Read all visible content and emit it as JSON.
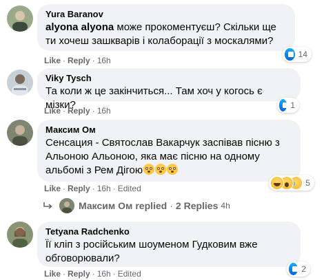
{
  "comments": [
    {
      "author": "Yura Baranov",
      "mention": "alyona alyona",
      "text": " може прокоментуєш? Скільки ще ти хочеш зашкварів і колаборації з москалями?",
      "actions": {
        "like": "Like",
        "reply": "Reply",
        "time": "16h"
      },
      "reaction_count": "14",
      "reaction_types": [
        "like"
      ]
    },
    {
      "author": "Viky Tysch",
      "text": "Та коли ж це закінчиться... Там хоч у когось є мізки?",
      "actions": {
        "like": "Like",
        "reply": "Reply",
        "time": "16h"
      },
      "reaction_count": "1",
      "reaction_types": [
        "like"
      ]
    },
    {
      "author": "Максим Ом",
      "text": "Сенсация - Святослав Вакарчук заспівав пісню з Альоною Альоною, яка має пісню на одному альбомі з Рем Дігою",
      "emoji_count": 3,
      "actions": {
        "like": "Like",
        "reply": "Reply",
        "time": "16h",
        "edited": "Edited"
      },
      "reaction_count": "5",
      "reaction_types": [
        "haha",
        "wow",
        "sad"
      ],
      "replies": {
        "name": "Максим Ом",
        "label": "replied",
        "count_label": "2 Replies",
        "time": "4h"
      }
    },
    {
      "author": "Tetyana Radchenko",
      "text": "Її кліп з російським шоуменом Гудковим вже обговорювали?",
      "actions": {
        "like": "Like",
        "reply": "Reply",
        "time": "16h",
        "edited": "Edited"
      },
      "reaction_count": "2",
      "reaction_types": [
        "like"
      ]
    }
  ],
  "colors": {
    "bubble": "#f0f2f5",
    "meta_text": "#65676b",
    "like_blue": "#1877f2"
  }
}
